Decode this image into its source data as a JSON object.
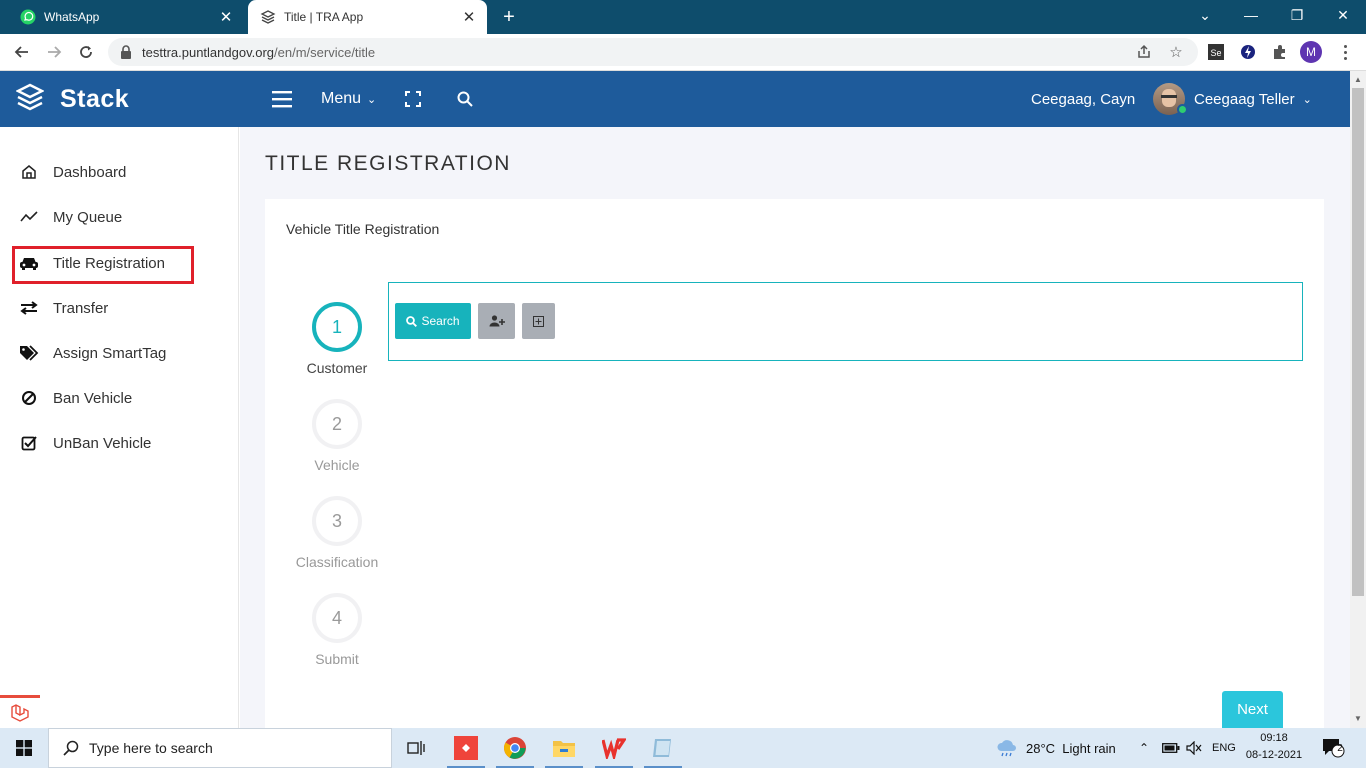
{
  "browser": {
    "tabs": [
      {
        "label": "WhatsApp"
      },
      {
        "label": "Title | TRA App"
      }
    ],
    "url_host": "testtra.puntlandgov.org",
    "url_path": "/en/m/service/title",
    "profile_initial": "M"
  },
  "app": {
    "brand": "Stack",
    "menu_label": "Menu",
    "location": "Ceegaag, Cayn",
    "user_name": "Ceegaag Teller"
  },
  "sidebar": {
    "items": [
      {
        "label": "Dashboard",
        "icon": "home-icon"
      },
      {
        "label": "My Queue",
        "icon": "trend-line-icon"
      },
      {
        "label": "Title Registration",
        "icon": "car-icon"
      },
      {
        "label": "Transfer",
        "icon": "exchange-arrows-icon"
      },
      {
        "label": "Assign SmartTag",
        "icon": "tags-icon"
      },
      {
        "label": "Ban Vehicle",
        "icon": "ban-icon"
      },
      {
        "label": "UnBan Vehicle",
        "icon": "check-square-icon"
      }
    ],
    "selected": "Title Registration"
  },
  "page": {
    "title": "TITLE REGISTRATION",
    "card_title": "Vehicle Title Registration",
    "steps": [
      {
        "number": "1",
        "label": "Customer",
        "active": true
      },
      {
        "number": "2",
        "label": "Vehicle",
        "active": false
      },
      {
        "number": "3",
        "label": "Classification",
        "active": false
      },
      {
        "number": "4",
        "label": "Submit",
        "active": false
      }
    ],
    "search_button": "Search",
    "next_button": "Next"
  },
  "taskbar": {
    "search_placeholder": "Type here to search",
    "weather": "28°C  Light rain",
    "language": "ENG",
    "time": "09:18",
    "date": "08-12-2021",
    "notification_count": "2"
  },
  "colors": {
    "header": "#1e5b9b",
    "accent": "#17b3bc",
    "highlight": "#e0202a",
    "next": "#2bc6dc"
  }
}
